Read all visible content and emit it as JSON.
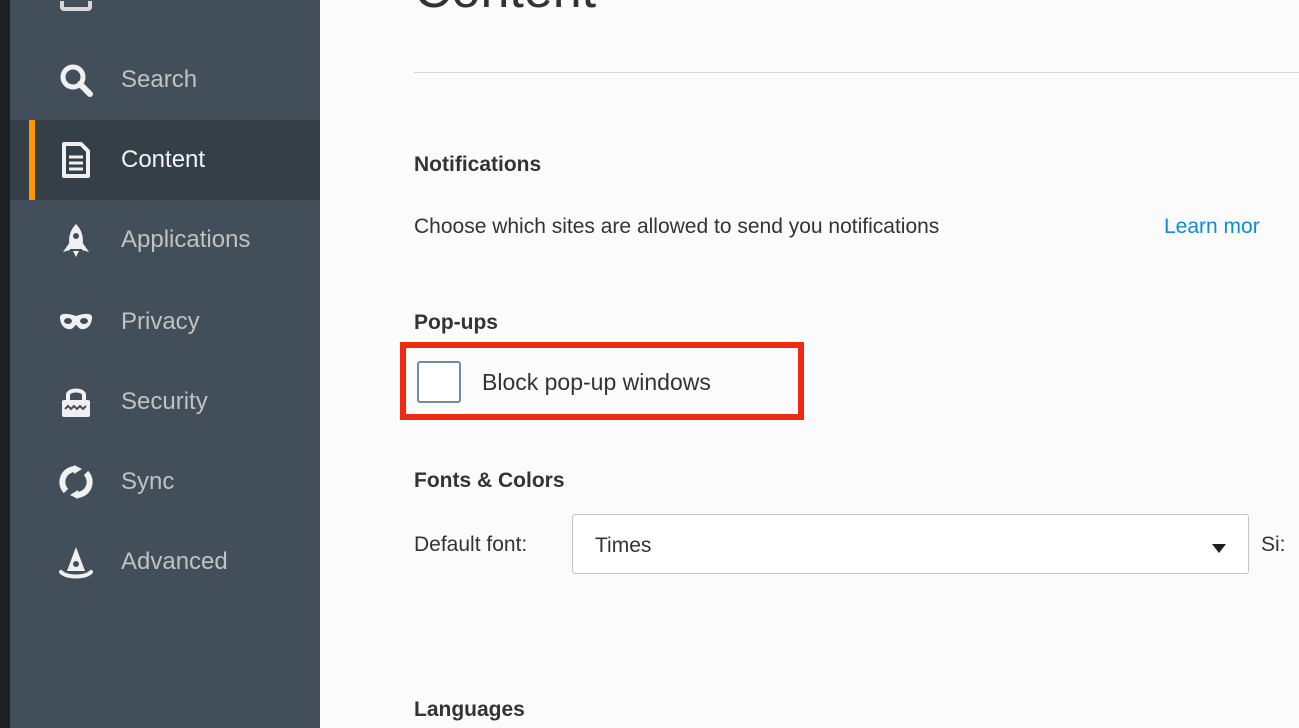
{
  "sidebar": {
    "items": [
      {
        "label": "Search",
        "icon": "search-icon"
      },
      {
        "label": "Content",
        "icon": "document-icon",
        "selected": true
      },
      {
        "label": "Applications",
        "icon": "rocket-icon"
      },
      {
        "label": "Privacy",
        "icon": "mask-icon"
      },
      {
        "label": "Security",
        "icon": "lock-icon"
      },
      {
        "label": "Sync",
        "icon": "sync-icon"
      },
      {
        "label": "Advanced",
        "icon": "wizard-hat-icon"
      }
    ],
    "accent_color": "#ff9500"
  },
  "main": {
    "title": "Content",
    "notifications": {
      "heading": "Notifications",
      "description": "Choose which sites are allowed to send you notifications",
      "learn_more": "Learn mor"
    },
    "popups": {
      "heading": "Pop-ups",
      "checkbox_label": "Block pop-up windows",
      "checked": false,
      "highlight_color": "#ee2a12"
    },
    "fonts": {
      "heading": "Fonts & Colors",
      "default_font_label": "Default font:",
      "default_font_value": "Times",
      "size_label": "Si:"
    },
    "languages": {
      "heading": "Languages"
    }
  }
}
